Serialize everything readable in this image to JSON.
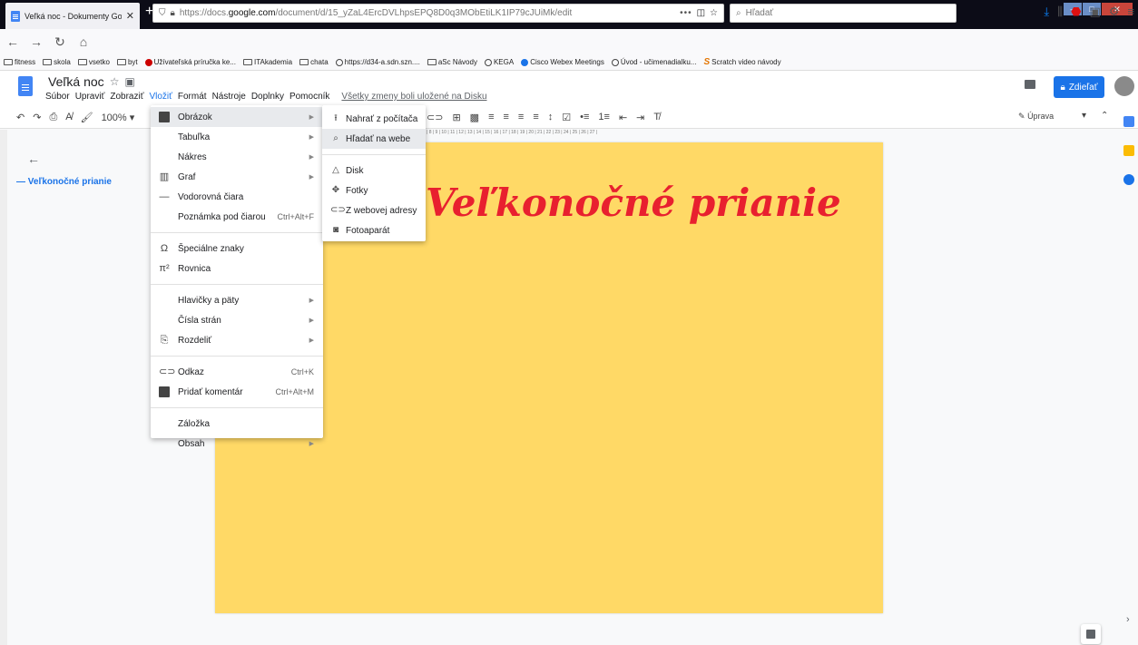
{
  "browser": {
    "tab_title": "Veľká noc - Dokumenty Google",
    "tab_close": "✕",
    "new_tab": "+",
    "url_plain_prefix": "https://docs.",
    "url_domain": "google.com",
    "url_rest": "/document/d/15_yZaL4ErcDVLhpsEPQ8D0q3MObEtiLK1IP79cJUiMk/edit",
    "url_more": "•••",
    "search_placeholder": "Hľadať"
  },
  "bookmarks": [
    {
      "label": "fitness",
      "icon": "folder-icon"
    },
    {
      "label": "skola",
      "icon": "folder-icon"
    },
    {
      "label": "vsetko",
      "icon": "folder-icon"
    },
    {
      "label": "byt",
      "icon": "folder-icon"
    },
    {
      "label": "Užívateľská príručka ke...",
      "icon": "red-circle-icon"
    },
    {
      "label": "ITAkademia",
      "icon": "folder-icon"
    },
    {
      "label": "chata",
      "icon": "folder-icon"
    },
    {
      "label": "https://d34-a.sdn.szn....",
      "icon": "globe-icon"
    },
    {
      "label": "aSc Návody",
      "icon": "help-icon"
    },
    {
      "label": "KEGA",
      "icon": "globe-icon"
    },
    {
      "label": "Cisco Webex Meetings",
      "icon": "webex-icon"
    },
    {
      "label": "Úvod - učimenadialku...",
      "icon": "globe-icon"
    },
    {
      "label": "Scratch video návody",
      "icon": "scratch-icon"
    }
  ],
  "doc": {
    "title": "Veľká noc",
    "star": "☆",
    "menu": [
      "Súbor",
      "Upraviť",
      "Zobraziť",
      "Vložiť",
      "Formát",
      "Nástroje",
      "Doplnky",
      "Pomocník"
    ],
    "active_menu_index": 3,
    "saved_status": "Všetky zmeny boli uložené na Disku",
    "share_label": "Zdieľať",
    "zoom": "100%",
    "mode_label": "Úprava",
    "outline_item": "Veľkonočné prianie",
    "page_heading": "Veľkonočné prianie",
    "page_color": "#ffd966",
    "heading_color": "#e8202f"
  },
  "insert_menu": [
    {
      "label": "Obrázok",
      "icon": "image-icon",
      "submenu": true,
      "highlighted": true
    },
    {
      "label": "Tabuľka",
      "icon": "",
      "submenu": true
    },
    {
      "label": "Nákres",
      "icon": "",
      "submenu": true
    },
    {
      "label": "Graf",
      "icon": "chart-icon",
      "submenu": true
    },
    {
      "label": "Vodorovná čiara",
      "icon": "horizontal-line-icon"
    },
    {
      "label": "Poznámka pod čiarou",
      "icon": "",
      "shortcut": "Ctrl+Alt+F"
    },
    {
      "separator": true
    },
    {
      "label": "Špeciálne znaky",
      "icon": "omega-icon"
    },
    {
      "label": "Rovnica",
      "icon": "pi-icon"
    },
    {
      "separator": true
    },
    {
      "label": "Hlavičky a päty",
      "icon": "",
      "submenu": true
    },
    {
      "label": "Čísla strán",
      "icon": "",
      "submenu": true
    },
    {
      "label": "Rozdeliť",
      "icon": "page-break-icon",
      "submenu": true
    },
    {
      "separator": true
    },
    {
      "label": "Odkaz",
      "icon": "link-icon",
      "shortcut": "Ctrl+K"
    },
    {
      "label": "Pridať komentár",
      "icon": "add-comment-icon",
      "shortcut": "Ctrl+Alt+M"
    },
    {
      "separator": true
    },
    {
      "label": "Záložka",
      "icon": ""
    },
    {
      "label": "Obsah",
      "icon": "",
      "submenu": true
    }
  ],
  "image_submenu": [
    {
      "label": "Nahrať z počítača",
      "icon": "upload-icon"
    },
    {
      "label": "Hľadať na webe",
      "icon": "search-icon",
      "highlighted": true
    },
    {
      "separator": true
    },
    {
      "label": "Disk",
      "icon": "drive-icon"
    },
    {
      "label": "Fotky",
      "icon": "photos-icon"
    },
    {
      "label": "Z webovej adresy",
      "icon": "link-icon"
    },
    {
      "label": "Fotoaparát",
      "icon": "camera-icon"
    }
  ]
}
